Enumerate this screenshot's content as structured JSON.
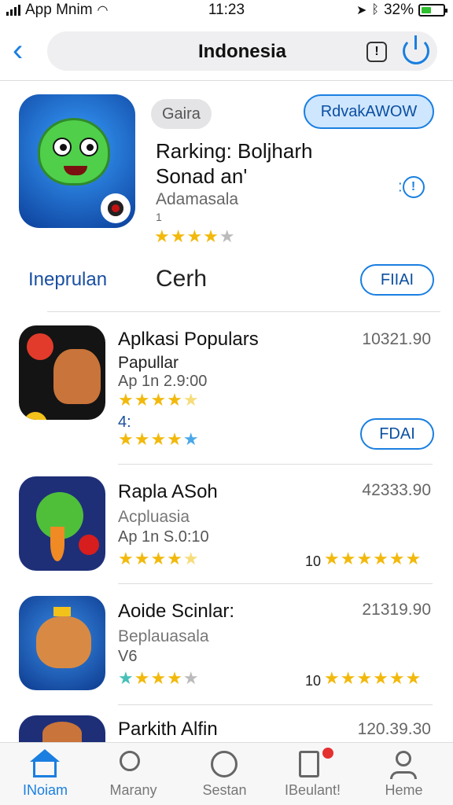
{
  "status": {
    "carrier": "App Mnim",
    "time": "11:23",
    "battery": "32%"
  },
  "nav": {
    "title": "Indonesia"
  },
  "featured": {
    "tag": "Gaira",
    "get_label": "RdvakAWOW",
    "title_line1": "Rarking: Boljharh",
    "title_line2": "Sonad an'",
    "subtitle": "Adamasala",
    "dot": "1",
    "stars": "★★★★",
    "stars_half": "★"
  },
  "tabs": {
    "active": "Ineprulan",
    "other": "Cerh",
    "button": "FIIAI"
  },
  "apps": [
    {
      "name": "Aplkasi Populars",
      "category": "Papullar",
      "meta": "Ap 1n 2.9:00",
      "extra": "4:",
      "price": "10321.90",
      "button": "FDAI",
      "stars1": "★★★★",
      "stars1_dim": "★",
      "stars2": "★★★★",
      "stars2_blue": "★"
    },
    {
      "name": "Rapla ASoh",
      "category": "Acpluasia",
      "meta": "Ap 1n S.0:10",
      "price": "42333.90",
      "rating_count": "10",
      "stars": "★★★★",
      "stars_dim": "★",
      "rating_stars": "★★★★★★"
    },
    {
      "name": "Aoide Scinlar:",
      "category": "Beplauasala",
      "meta": "V6",
      "price": "21319.90",
      "rating_count": "10",
      "stars_teal": "★",
      "stars": "★★★",
      "stars_dim": "★",
      "rating_stars": "★★★★★★"
    },
    {
      "name": "Parkith Alfin",
      "price": "120.39.30"
    }
  ],
  "tabbar": [
    {
      "label": "INoiam"
    },
    {
      "label": "Marany"
    },
    {
      "label": "Sestan"
    },
    {
      "label": "IBeulant!"
    },
    {
      "label": "Heme"
    }
  ]
}
